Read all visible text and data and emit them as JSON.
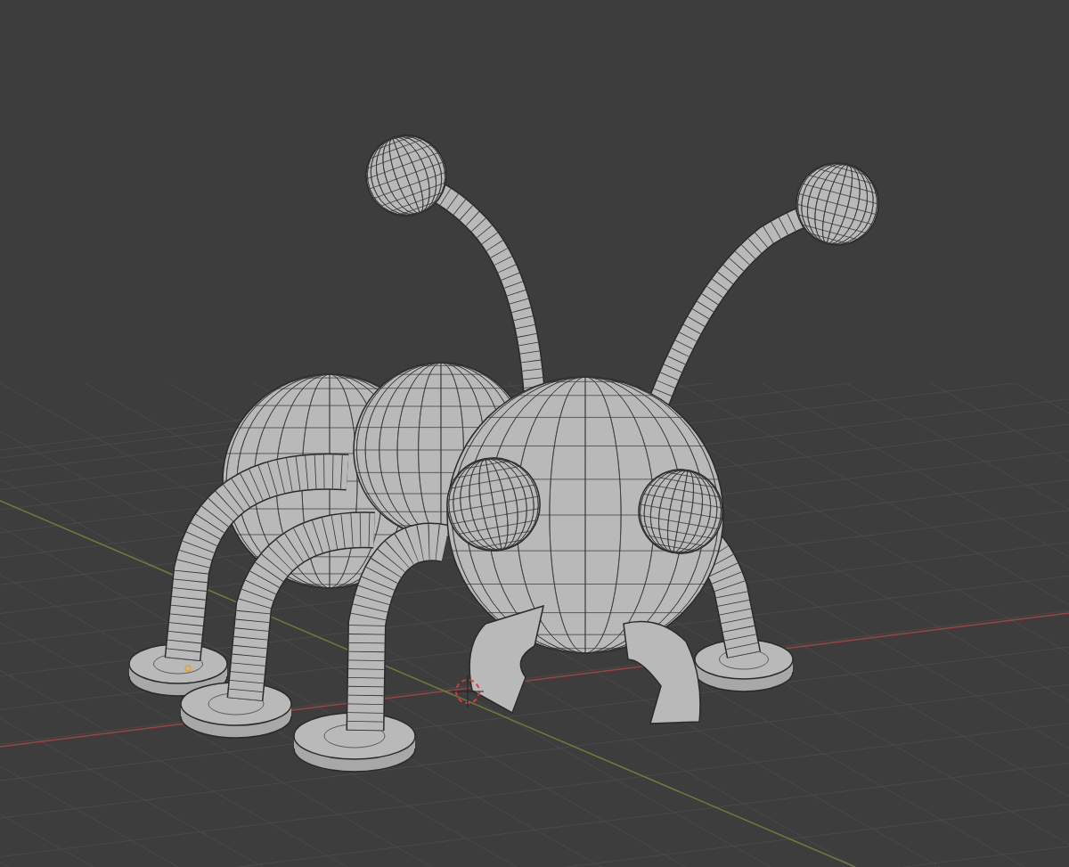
{
  "viewport": {
    "grid": true,
    "x_axis": true,
    "y_axis": true,
    "cursor_3d": true,
    "origin_point": true
  }
}
